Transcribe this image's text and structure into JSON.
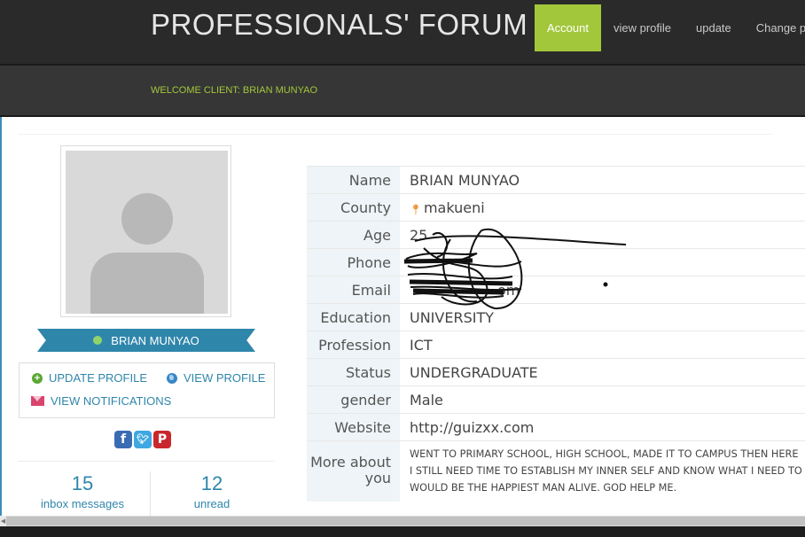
{
  "header": {
    "brand": "PROFESSIONALS' FORUM",
    "nav": [
      "Account",
      "view profile",
      "update",
      "Change p"
    ],
    "active_nav": "Account",
    "accent_color": "#a2c73a"
  },
  "welcome": "WELCOME CLIENT: BRIAN MUNYAO",
  "sidebar": {
    "name": "BRIAN MUNYAO",
    "online_status_color": "#8fd36a",
    "links": {
      "update_profile": "UPDATE PROFILE",
      "view_profile": "VIEW PROFILE",
      "view_notifications": "VIEW NOTIFICATIONS"
    },
    "social": [
      "facebook-icon",
      "twitter-icon",
      "pinterest-icon"
    ],
    "stats": [
      {
        "value": "15",
        "label": "inbox messages"
      },
      {
        "value": "12",
        "label": "unread"
      }
    ]
  },
  "profile": {
    "rows": [
      {
        "label": "Name",
        "value": "BRIAN MUNYAO"
      },
      {
        "label": "County",
        "value": "makueni"
      },
      {
        "label": "Age",
        "value": "25"
      },
      {
        "label": "Phone",
        "value": ""
      },
      {
        "label": "Email",
        "value": "om"
      },
      {
        "label": "Education Level",
        "value": "UNIVERSITY"
      },
      {
        "label": "Profession",
        "value": "ICT"
      },
      {
        "label": "Status",
        "value": "UNDERGRADUATE"
      },
      {
        "label": "gender",
        "value": "Male"
      },
      {
        "label": "Website",
        "value": "http://guizxx.com"
      }
    ],
    "about": {
      "label_line1": "More about",
      "label_line2": "you",
      "lines": [
        "WENT TO PRIMARY SCHOOL, HIGH SCHOOL, MADE IT TO CAMPUS THEN HERE",
        "I STILL NEED TIME TO ESTABLISH MY INNER SELF AND KNOW WHAT I NEED TO",
        "WOULD BE THE HAPPIEST MAN ALIVE. GOD HELP ME."
      ]
    }
  }
}
